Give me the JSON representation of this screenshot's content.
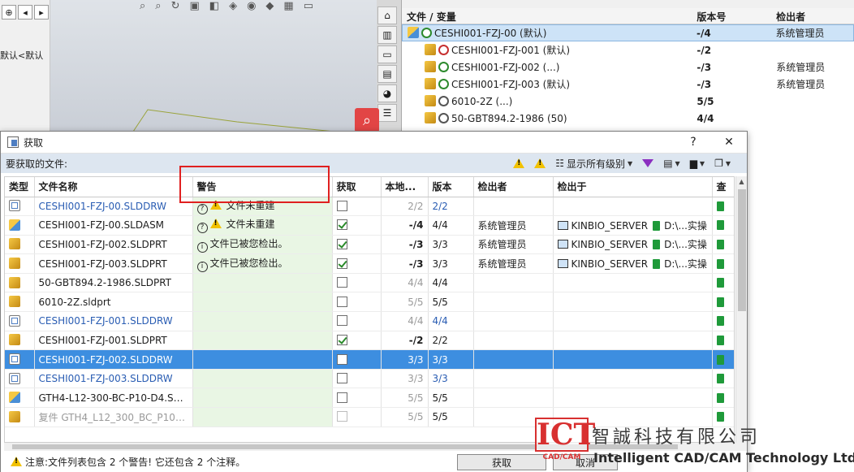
{
  "background": {
    "left_crumb": "默认<默认",
    "tree_header": {
      "file": "文件 / 变量",
      "version": "版本号",
      "checkout": "检出者"
    },
    "tree_rows": [
      {
        "name": "CESHI001-FZJ-00  (默认)",
        "version": "-/4",
        "checkout": "系统管理员",
        "type": "asm",
        "state": "green",
        "selected": true,
        "indent": false
      },
      {
        "name": "CESHI001-FZJ-001  (默认)",
        "version": "-/2",
        "checkout": "",
        "type": "part",
        "state": "red",
        "selected": false,
        "indent": true
      },
      {
        "name": "CESHI001-FZJ-002  (...)",
        "version": "-/3",
        "checkout": "系统管理员",
        "type": "part",
        "state": "green",
        "selected": false,
        "indent": true
      },
      {
        "name": "CESHI001-FZJ-003  (默认)",
        "version": "-/3",
        "checkout": "系统管理员",
        "type": "part",
        "state": "green",
        "selected": false,
        "indent": true
      },
      {
        "name": "6010-2Z  (...)",
        "version": "5/5",
        "checkout": "",
        "type": "part",
        "state": "gray",
        "selected": false,
        "indent": true
      },
      {
        "name": "50-GBT894.2-1986  (50)",
        "version": "4/4",
        "checkout": "",
        "type": "part",
        "state": "gray",
        "selected": false,
        "indent": true
      }
    ]
  },
  "dialog": {
    "title": "获取",
    "help_label": "?",
    "close_label": "✕",
    "files_label": "要获取的文件:",
    "show_levels_label": "显示所有级别",
    "columns": [
      "类型",
      "文件名称",
      "警告",
      "获取",
      "本地...",
      "版本",
      "检出者",
      "检出于",
      "查"
    ],
    "rows": [
      {
        "type": "drw",
        "name": "CESHI001-FZJ-00.SLDDRW",
        "warn_icon": "q-warn",
        "warning": "文件未重建",
        "get": false,
        "local": "2/2",
        "version": "2/2",
        "checkout_by": "",
        "checkout_at": "",
        "local_style": "muted",
        "ver_style": "blue"
      },
      {
        "type": "asm",
        "name": "CESHI001-FZJ-00.SLDASM",
        "warn_icon": "q-warn",
        "warning": "文件未重建",
        "get": true,
        "local": "-/4",
        "version": "4/4",
        "checkout_by": "系统管理员",
        "checkout_at": "KINBIO_SERVER",
        "path": "D:\\...实操",
        "local_style": "bold",
        "ver_style": ""
      },
      {
        "type": "part",
        "name": "CESHI001-FZJ-002.SLDPRT",
        "warn_icon": "info",
        "warning": "文件已被您检出。",
        "get": true,
        "local": "-/3",
        "version": "3/3",
        "checkout_by": "系统管理员",
        "checkout_at": "KINBIO_SERVER",
        "path": "D:\\...实操",
        "local_style": "bold",
        "ver_style": ""
      },
      {
        "type": "part",
        "name": "CESHI001-FZJ-003.SLDPRT",
        "warn_icon": "info",
        "warning": "文件已被您检出。",
        "get": true,
        "local": "-/3",
        "version": "3/3",
        "checkout_by": "系统管理员",
        "checkout_at": "KINBIO_SERVER",
        "path": "D:\\...实操",
        "local_style": "bold",
        "ver_style": ""
      },
      {
        "type": "part",
        "name": "50-GBT894.2-1986.SLDPRT",
        "warn_icon": "",
        "warning": "",
        "get": false,
        "local": "4/4",
        "version": "4/4",
        "checkout_by": "",
        "checkout_at": "",
        "local_style": "muted",
        "ver_style": ""
      },
      {
        "type": "part",
        "name": "6010-2Z.sldprt",
        "warn_icon": "",
        "warning": "",
        "get": false,
        "local": "5/5",
        "version": "5/5",
        "checkout_by": "",
        "checkout_at": "",
        "local_style": "muted",
        "ver_style": ""
      },
      {
        "type": "drw",
        "name": "CESHI001-FZJ-001.SLDDRW",
        "warn_icon": "",
        "warning": "",
        "get": false,
        "local": "4/4",
        "version": "4/4",
        "checkout_by": "",
        "checkout_at": "",
        "local_style": "muted",
        "ver_style": "blue"
      },
      {
        "type": "part",
        "name": "CESHI001-FZJ-001.SLDPRT",
        "warn_icon": "",
        "warning": "",
        "get": true,
        "local": "-/2",
        "version": "2/2",
        "checkout_by": "",
        "checkout_at": "",
        "local_style": "bold",
        "ver_style": ""
      },
      {
        "type": "drw",
        "name": "CESHI001-FZJ-002.SLDDRW",
        "warn_icon": "",
        "warning": "",
        "get": false,
        "local": "3/3",
        "version": "3/3",
        "checkout_by": "",
        "checkout_at": "",
        "local_style": "muted",
        "ver_style": "",
        "selected": true
      },
      {
        "type": "drw",
        "name": "CESHI001-FZJ-003.SLDDRW",
        "warn_icon": "",
        "warning": "",
        "get": false,
        "local": "3/3",
        "version": "3/3",
        "checkout_by": "",
        "checkout_at": "",
        "local_style": "muted",
        "ver_style": "blue"
      },
      {
        "type": "asm",
        "name": "GTH4-L12-300-BC-P10-D4.SLDAS...",
        "warn_icon": "",
        "warning": "",
        "get": false,
        "local": "5/5",
        "version": "5/5",
        "checkout_by": "",
        "checkout_at": "",
        "local_style": "muted",
        "ver_style": ""
      },
      {
        "type": "part",
        "name": "复件 GTH4_L12_300_BC_P10_D4_...",
        "warn_icon": "",
        "warning": "",
        "get": false,
        "local": "5/5",
        "version": "5/5",
        "checkout_by": "",
        "checkout_at": "",
        "local_style": "muted",
        "ver_style": "",
        "dim_name": true
      }
    ],
    "footer_message": "注意:文件列表包含 2 个警告! 它还包含 2 个注释。",
    "get_button": "获取",
    "cancel_button": "取消"
  },
  "watermark": {
    "logo": "ICT",
    "logo_sub": "CAD/CAM",
    "company_cn": "智誠科技有限公司",
    "company_en": "Intelligent CAD/CAM Technology Ltd."
  },
  "colors": {
    "selection": "#3d8ee0",
    "warning_col": "#e9f6e4",
    "highlight_box": "#e02020",
    "drawing_link": "#2a5db3"
  }
}
